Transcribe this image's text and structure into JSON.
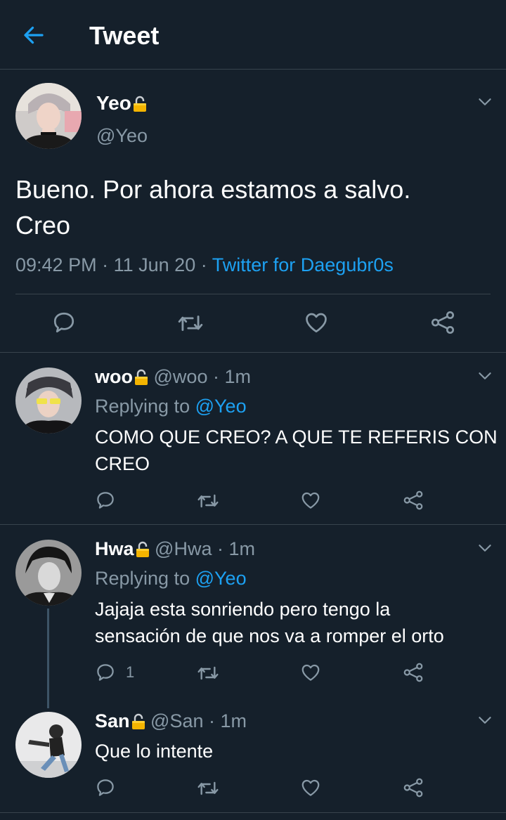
{
  "header": {
    "title": "Tweet"
  },
  "main_tweet": {
    "name": "Yeo",
    "handle": "@Yeo",
    "text_line1": "Bueno. Por ahora estamos a salvo.",
    "text_line2": "Creo",
    "time": "09:42 PM",
    "date": "11 Jun 20",
    "source": "Twitter for Daegubr0s"
  },
  "replies": [
    {
      "name": "woo",
      "handle": "@woo",
      "time": "1m",
      "replying_prefix": "Replying to",
      "replying_to": "@Yeo",
      "text_line1": "COMO QUE CREO? A QUE TE REFERIS CON",
      "text_line2": "CREO",
      "reply_count": ""
    },
    {
      "name": "Hwa",
      "handle": "@Hwa",
      "time": "1m",
      "replying_prefix": "Replying to",
      "replying_to": "@Yeo",
      "text_line1": "Jajaja esta sonriendo pero tengo la",
      "text_line2": "sensación de que nos va a romper el orto",
      "reply_count": "1"
    },
    {
      "name": "San",
      "handle": "@San",
      "time": "1m",
      "text_line1": "Que lo intente",
      "reply_count": ""
    }
  ],
  "separator": "·",
  "icons": {
    "back": "back-arrow-icon",
    "lock": "lock-icon",
    "chevron": "chevron-down-icon",
    "reply": "reply-icon",
    "retweet": "retweet-icon",
    "like": "heart-icon",
    "share": "share-icon"
  },
  "colors": {
    "background": "#15202b",
    "accent": "#1da1f2",
    "muted": "#8899a6",
    "divider": "#38444d",
    "lock": "#f4b400"
  }
}
